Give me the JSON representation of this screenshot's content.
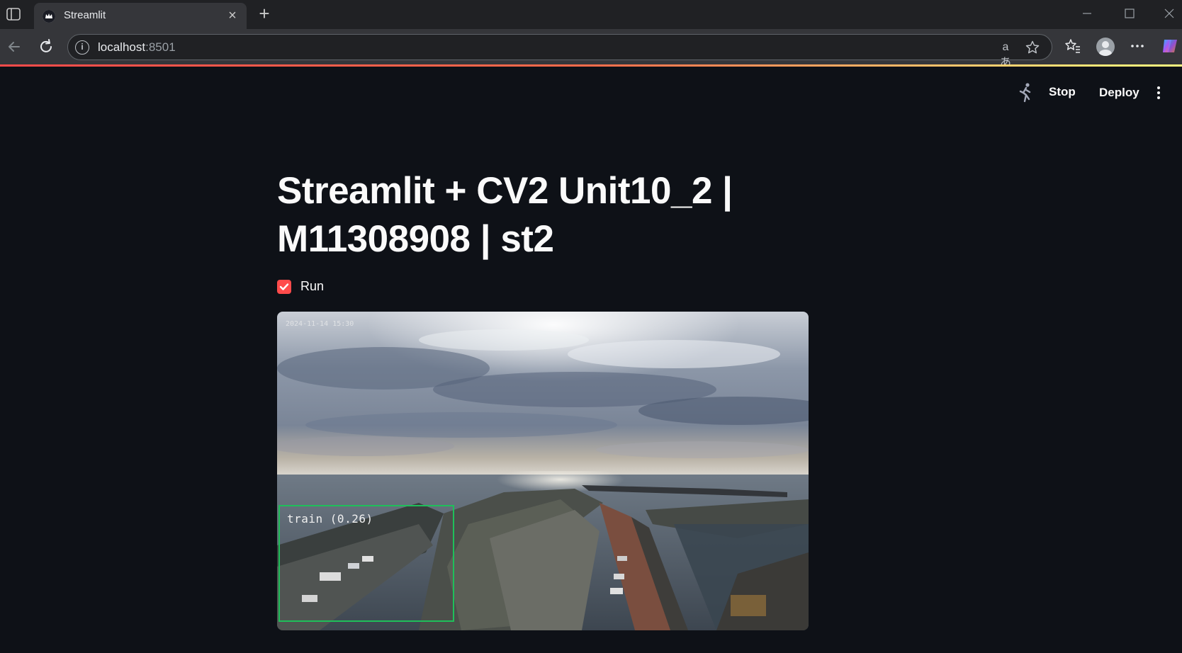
{
  "browser": {
    "tab_title": "Streamlit",
    "url_host": "localhost",
    "url_port": ":8501"
  },
  "icons": {
    "tab_sidebar": "tab-sidebar-icon",
    "favicon": "streamlit-crown-icon",
    "close": "close-icon",
    "new_tab": "plus-icon",
    "back": "back-arrow-icon",
    "reload": "reload-icon",
    "info": "info-icon",
    "translate": "translate-icon",
    "star": "star-icon",
    "favorites": "favorites-icon",
    "profile": "profile-icon",
    "more": "more-icon",
    "copilot": "copilot-icon",
    "running": "running-man-icon",
    "menu": "vertical-dots-icon"
  },
  "header": {
    "stop_label": "Stop",
    "deploy_label": "Deploy"
  },
  "main": {
    "title_line1": "Streamlit + CV2 Unit10_2 |",
    "title_line2": "M11308908 | st2",
    "checkbox": {
      "label": "Run",
      "checked": true
    },
    "frame": {
      "detection_label": "train (0.26)",
      "camera_stamp": "2024-11-14 15:30"
    }
  },
  "colors": {
    "background": "#0e1117",
    "accent": "#ff4b4b",
    "detection_box": "#1fbf5a"
  }
}
